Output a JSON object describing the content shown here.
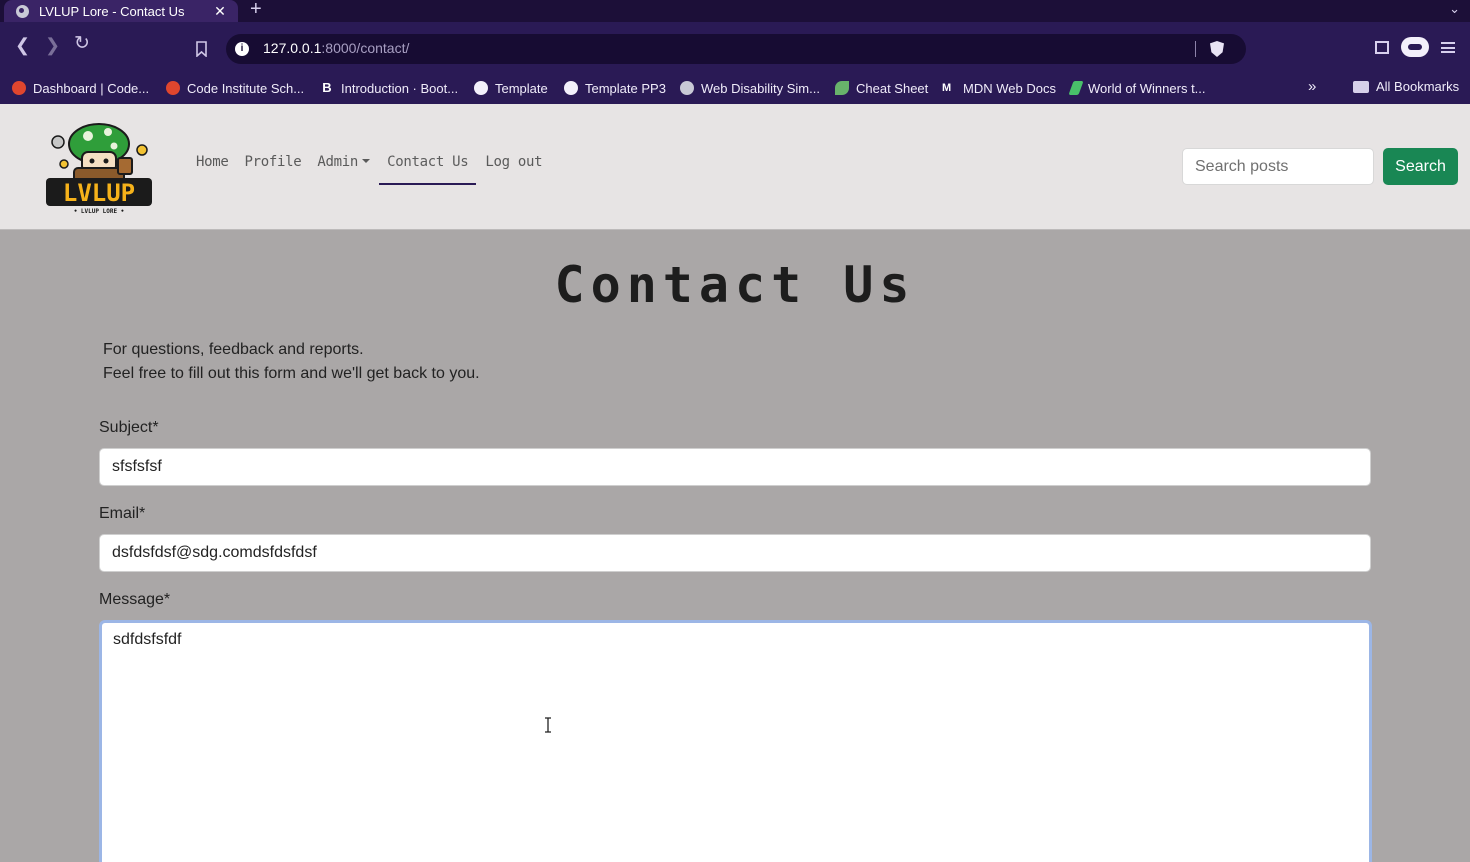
{
  "browser": {
    "tab_title": "LVLUP Lore -  Contact Us",
    "tab_close": "✕",
    "new_tab": "+",
    "tab_list": "⌄",
    "url_host": "127.0.0.1",
    "url_path": ":8000/contact/",
    "back": "❮",
    "forward": "❯",
    "reload": "↻",
    "bookmarks": [
      {
        "label": "Dashboard | Code...",
        "icon": "red"
      },
      {
        "label": "Code Institute Sch...",
        "icon": "red"
      },
      {
        "label": "Introduction · Boot...",
        "icon": "b"
      },
      {
        "label": "Template",
        "icon": "gh"
      },
      {
        "label": "Template PP3",
        "icon": "gh"
      },
      {
        "label": "Web Disability Sim...",
        "icon": "globe"
      },
      {
        "label": "Cheat Sheet",
        "icon": "leaf"
      },
      {
        "label": "MDN Web Docs",
        "icon": "mdn"
      },
      {
        "label": "World of Winners t...",
        "icon": "win"
      }
    ],
    "bookmarks_more": "»",
    "all_bookmarks": "All Bookmarks"
  },
  "site": {
    "logo_text": "LVLUP",
    "logo_subtext": "• LVLUP LORE •",
    "nav": {
      "home": "Home",
      "profile": "Profile",
      "admin": "Admin",
      "contact": "Contact Us",
      "logout": "Log out"
    },
    "search_placeholder": "Search posts",
    "search_button": "Search"
  },
  "page": {
    "title": "Contact Us",
    "intro_line1": "For questions, feedback and reports.",
    "intro_line2": "Feel free to fill out this form and we'll get back to you.",
    "subject_label": "Subject*",
    "subject_value": "sfsfsfsf",
    "email_label": "Email*",
    "email_value": "dsfdsfdsf@sdg.comdsfdsfdsf",
    "message_label": "Message*",
    "message_value": "sdfdsfsfdf"
  },
  "colors": {
    "browser_chrome": "#2a1a55",
    "tabbar": "#1c0f38",
    "nav_bg": "#e7e4e4",
    "page_bg": "#aaa7a7",
    "search_button": "#198754",
    "focus_ring": "#9cb6e6"
  }
}
